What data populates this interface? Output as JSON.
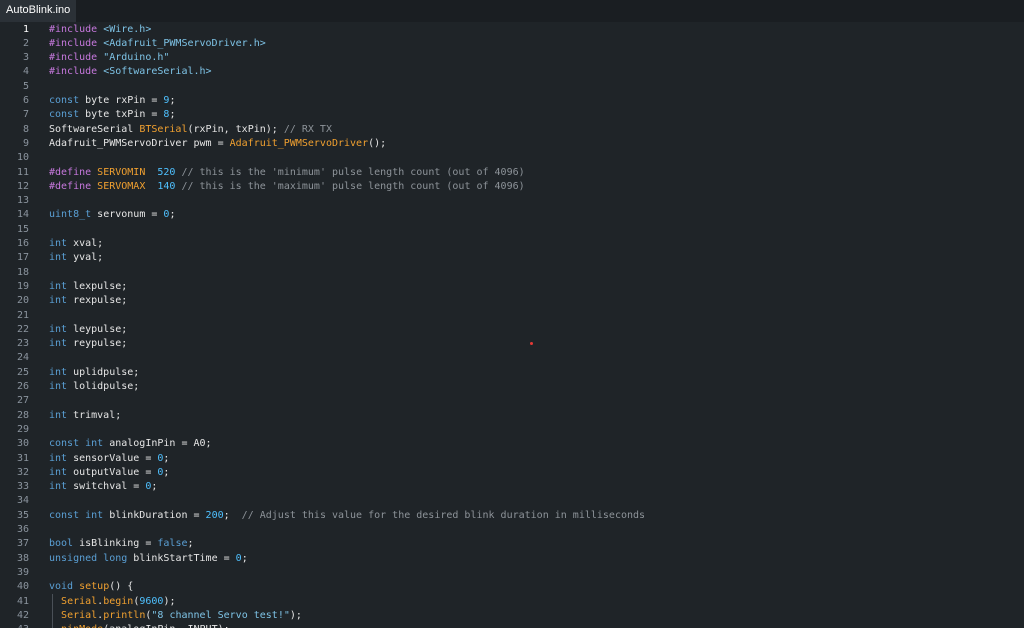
{
  "tab": {
    "filename": "AutoBlink.ino"
  },
  "active_line": 1,
  "colors": {
    "preprocessor": "#c678dd",
    "string": "#7ec3e6",
    "keyword": "#5a9fd4",
    "number": "#4fc1ff",
    "comment": "#8d9399",
    "function": "#f0a030",
    "plain": "#e6e6e6"
  },
  "lines": [
    [
      [
        "pre",
        "#include "
      ],
      [
        "str",
        "<Wire.h>"
      ]
    ],
    [
      [
        "pre",
        "#include "
      ],
      [
        "str",
        "<Adafruit_PWMServoDriver.h>"
      ]
    ],
    [
      [
        "pre",
        "#include "
      ],
      [
        "str",
        "\"Arduino.h\""
      ]
    ],
    [
      [
        "pre",
        "#include "
      ],
      [
        "str",
        "<SoftwareSerial.h>"
      ]
    ],
    [],
    [
      [
        "kw",
        "const"
      ],
      [
        "plain",
        " byte rxPin = "
      ],
      [
        "num",
        "9"
      ],
      [
        "plain",
        ";"
      ]
    ],
    [
      [
        "kw",
        "const"
      ],
      [
        "plain",
        " byte txPin = "
      ],
      [
        "num",
        "8"
      ],
      [
        "plain",
        ";"
      ]
    ],
    [
      [
        "plain",
        "SoftwareSerial "
      ],
      [
        "fn",
        "BTSerial"
      ],
      [
        "plain",
        "(rxPin, txPin); "
      ],
      [
        "com",
        "// RX TX"
      ]
    ],
    [
      [
        "plain",
        "Adafruit_PWMServoDriver pwm = "
      ],
      [
        "fn",
        "Adafruit_PWMServoDriver"
      ],
      [
        "plain",
        "();"
      ]
    ],
    [],
    [
      [
        "pre",
        "#define "
      ],
      [
        "fn",
        "SERVOMIN"
      ],
      [
        "plain",
        "  "
      ],
      [
        "num",
        "520"
      ],
      [
        "com",
        " // this is the 'minimum' pulse length count (out of 4096)"
      ]
    ],
    [
      [
        "pre",
        "#define "
      ],
      [
        "fn",
        "SERVOMAX"
      ],
      [
        "plain",
        "  "
      ],
      [
        "num",
        "140"
      ],
      [
        "com",
        " // this is the 'maximum' pulse length count (out of 4096)"
      ]
    ],
    [],
    [
      [
        "kw",
        "uint8_t"
      ],
      [
        "plain",
        " servonum = "
      ],
      [
        "num",
        "0"
      ],
      [
        "plain",
        ";"
      ]
    ],
    [],
    [
      [
        "kw",
        "int"
      ],
      [
        "plain",
        " xval;"
      ]
    ],
    [
      [
        "kw",
        "int"
      ],
      [
        "plain",
        " yval;"
      ]
    ],
    [],
    [
      [
        "kw",
        "int"
      ],
      [
        "plain",
        " lexpulse;"
      ]
    ],
    [
      [
        "kw",
        "int"
      ],
      [
        "plain",
        " rexpulse;"
      ]
    ],
    [],
    [
      [
        "kw",
        "int"
      ],
      [
        "plain",
        " leypulse;"
      ]
    ],
    [
      [
        "kw",
        "int"
      ],
      [
        "plain",
        " reypulse;"
      ]
    ],
    [],
    [
      [
        "kw",
        "int"
      ],
      [
        "plain",
        " uplidpulse;"
      ]
    ],
    [
      [
        "kw",
        "int"
      ],
      [
        "plain",
        " lolidpulse;"
      ]
    ],
    [],
    [
      [
        "kw",
        "int"
      ],
      [
        "plain",
        " trimval;"
      ]
    ],
    [],
    [
      [
        "kw",
        "const int"
      ],
      [
        "plain",
        " analogInPin = A0;"
      ]
    ],
    [
      [
        "kw",
        "int"
      ],
      [
        "plain",
        " sensorValue = "
      ],
      [
        "num",
        "0"
      ],
      [
        "plain",
        ";"
      ]
    ],
    [
      [
        "kw",
        "int"
      ],
      [
        "plain",
        " outputValue = "
      ],
      [
        "num",
        "0"
      ],
      [
        "plain",
        ";"
      ]
    ],
    [
      [
        "kw",
        "int"
      ],
      [
        "plain",
        " switchval = "
      ],
      [
        "num",
        "0"
      ],
      [
        "plain",
        ";"
      ]
    ],
    [],
    [
      [
        "kw",
        "const int"
      ],
      [
        "plain",
        " blinkDuration = "
      ],
      [
        "num",
        "200"
      ],
      [
        "plain",
        ";  "
      ],
      [
        "com",
        "// Adjust this value for the desired blink duration in milliseconds"
      ]
    ],
    [],
    [
      [
        "kw",
        "bool"
      ],
      [
        "plain",
        " isBlinking = "
      ],
      [
        "kw",
        "false"
      ],
      [
        "plain",
        ";"
      ]
    ],
    [
      [
        "kw",
        "unsigned long"
      ],
      [
        "plain",
        " blinkStartTime = "
      ],
      [
        "num",
        "0"
      ],
      [
        "plain",
        ";"
      ]
    ],
    [],
    [
      [
        "kw",
        "void"
      ],
      [
        "plain",
        " "
      ],
      [
        "fn",
        "setup"
      ],
      [
        "plain",
        "() {"
      ]
    ],
    [
      [
        "plain",
        "  "
      ],
      [
        "fn",
        "Serial"
      ],
      [
        "plain",
        "."
      ],
      [
        "fn",
        "begin"
      ],
      [
        "plain",
        "("
      ],
      [
        "num",
        "9600"
      ],
      [
        "plain",
        ");"
      ]
    ],
    [
      [
        "plain",
        "  "
      ],
      [
        "fn",
        "Serial"
      ],
      [
        "plain",
        "."
      ],
      [
        "fn",
        "println"
      ],
      [
        "plain",
        "("
      ],
      [
        "str",
        "\"8 channel Servo test!\""
      ],
      [
        "plain",
        ");"
      ]
    ],
    [
      [
        "plain",
        "  "
      ],
      [
        "fn",
        "pinMode"
      ],
      [
        "plain",
        "(analogInPin, INPUT);"
      ]
    ]
  ]
}
